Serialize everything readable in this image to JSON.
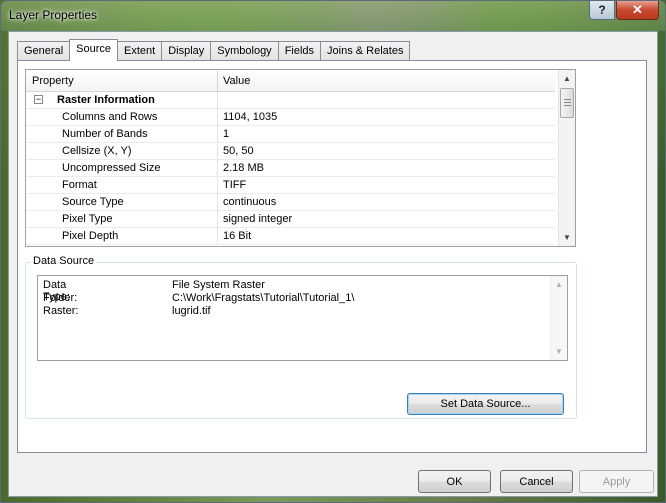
{
  "window": {
    "title": "Layer Properties",
    "help_label": "?",
    "close_label": "✕"
  },
  "tabs": [
    {
      "label": "General"
    },
    {
      "label": "Source"
    },
    {
      "label": "Extent"
    },
    {
      "label": "Display"
    },
    {
      "label": "Symbology"
    },
    {
      "label": "Fields"
    },
    {
      "label": "Joins & Relates"
    }
  ],
  "active_tab": "Source",
  "property_grid": {
    "header_property": "Property",
    "header_value": "Value",
    "group_label": "Raster Information",
    "group_expander": "−",
    "rows": [
      {
        "property": "Columns and Rows",
        "value": "1104, 1035"
      },
      {
        "property": "Number of Bands",
        "value": "1"
      },
      {
        "property": "Cellsize (X, Y)",
        "value": "50, 50"
      },
      {
        "property": "Uncompressed Size",
        "value": "2.18 MB"
      },
      {
        "property": "Format",
        "value": "TIFF"
      },
      {
        "property": "Source Type",
        "value": "continuous"
      },
      {
        "property": "Pixel Type",
        "value": "signed integer"
      },
      {
        "property": "Pixel Depth",
        "value": "16 Bit"
      }
    ],
    "scroll_up": "▲",
    "scroll_down": "▼"
  },
  "data_source": {
    "legend": "Data Source",
    "lines": [
      {
        "key": "Data Type:",
        "value": "File System Raster"
      },
      {
        "key": "Folder:",
        "value": "C:\\Work\\Fragstats\\Tutorial\\Tutorial_1\\"
      },
      {
        "key": "Raster:",
        "value": "lugrid.tif"
      }
    ],
    "set_button": "Set Data Source..."
  },
  "footer": {
    "ok": "OK",
    "cancel": "Cancel",
    "apply": "Apply"
  }
}
